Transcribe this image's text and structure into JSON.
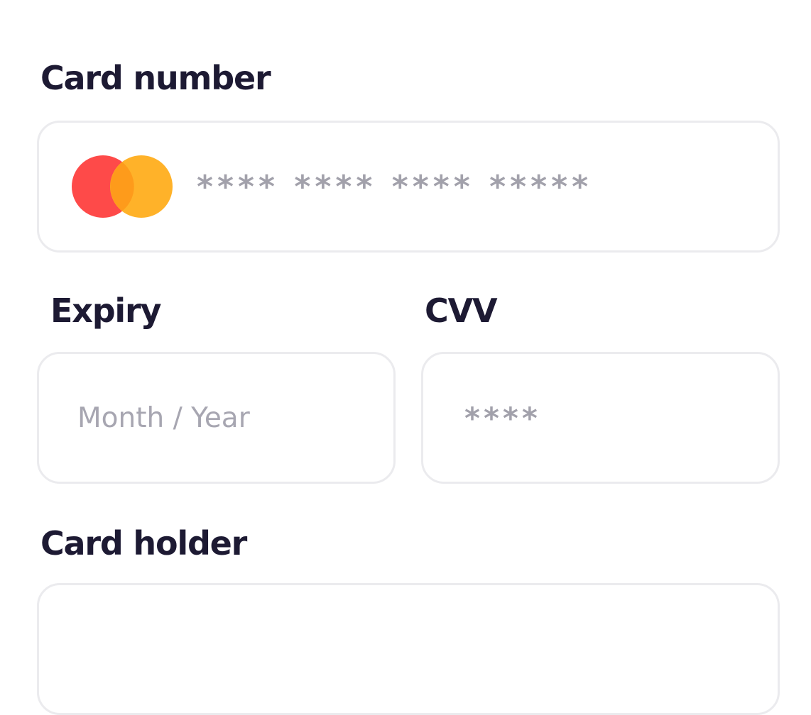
{
  "card_number": {
    "label": "Card number",
    "placeholder": "**** **** **** *****",
    "brand_icon": "mastercard-logo",
    "brand_colors": {
      "left": "#fe4a49",
      "right": "#ffb229",
      "overlap": "#fe9b1b"
    }
  },
  "expiry": {
    "label": "Expiry",
    "placeholder": "Month / Year"
  },
  "cvv": {
    "label": "CVV",
    "placeholder": "****"
  },
  "card_holder": {
    "label": "Card holder"
  },
  "colors": {
    "label_text": "#1d1a33",
    "placeholder_text": "#a7a6b1",
    "field_border": "#ebebee"
  }
}
